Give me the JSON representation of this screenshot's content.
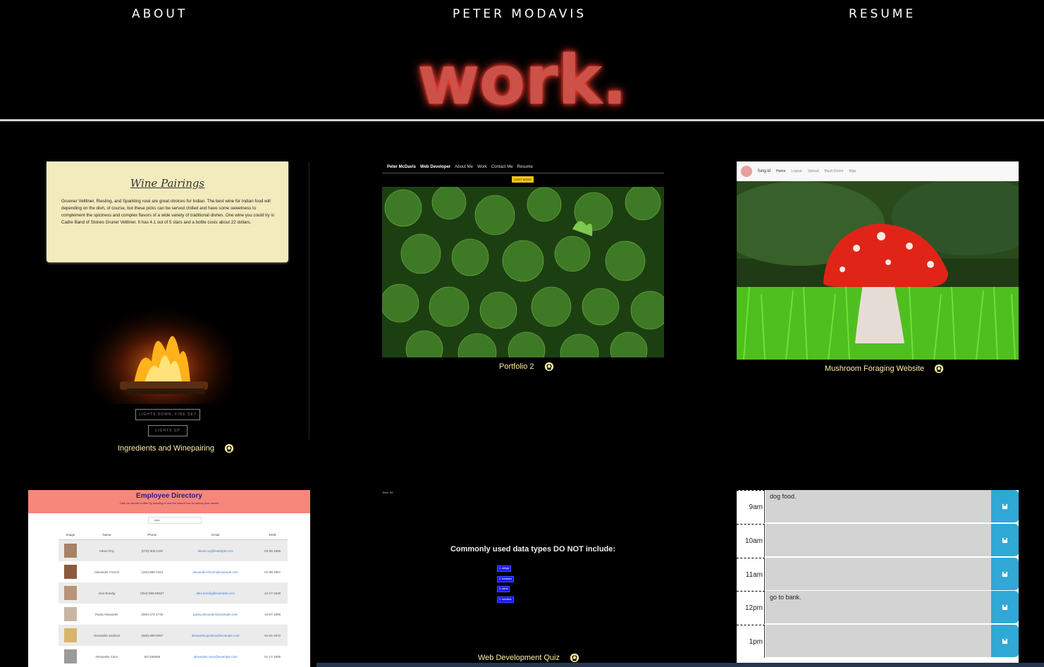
{
  "nav": {
    "about": "ABOUT",
    "name": "PETER MODAVIS",
    "resume": "RESUME"
  },
  "page_title": "work.",
  "projects": {
    "wine": {
      "caption": "Ingredients and Winepairing",
      "card_title": "Wine Pairings",
      "card_body": "Gruener Veltliner, Riesling, and Sparkling rosé are great choices for Indian. The best wine for Indian food will depending on the dish, of course, but these picks can be served chilled and have some sweetness to complement the spiciness and complex flavors of a wide variety of traditional dishes. One wine you could try is Cadre Band of Stones Gruner Veltliner. It has 4.1 out of 5 stars and a bottle costs about 22 dollars.",
      "btn_down": "LIGHTS DOWN, FIRE SET",
      "btn_up": "LIGHTS UP"
    },
    "portfolio": {
      "caption": "Portfolio 2",
      "nav_name": "Peter McDavis",
      "nav_role": "Web Developer",
      "nav_items": [
        "About Me",
        "Work",
        "Contact Me",
        "Resume"
      ],
      "light_mode": "LIGHT MODE"
    },
    "mushroom": {
      "caption": "Mushroom Foraging Website",
      "brand": "fung.id",
      "nav_items": [
        "Home",
        "Logout",
        "Upload",
        "Mush Room",
        "Map"
      ]
    },
    "employee": {
      "title": "Employee Directory",
      "subtitle": "Click on carrots to filter by heading or use the search box to narrow your results",
      "search_value": "Alex",
      "columns": [
        "Image",
        "Name",
        "Phone",
        "Email",
        "DOB"
      ],
      "rows": [
        {
          "name": "Alexis Roy",
          "phone": "(078)-305-1191",
          "email": "alexis.roy@example.com",
          "dob": "03-05-1956"
        },
        {
          "name": "Alexander French",
          "phone": "(150)-890-7261",
          "email": "alexander.french@example.com",
          "dob": "01-08-1967"
        },
        {
          "name": "Alex Bondig",
          "phone": "(064)-066-85227",
          "email": "alex.bondig@example.com",
          "dob": "12-17-1948"
        },
        {
          "name": "Paula Alexander",
          "phone": "(050)-272-1749",
          "email": "paula.alexander@example.com",
          "dob": "10-07-1990"
        },
        {
          "name": "Alexandra Jackson",
          "phone": "(360)-380-8067",
          "email": "alexandra.jackson@example.com",
          "dob": "01-01-1972"
        },
        {
          "name": "Alexander Cano",
          "phone": "927166556",
          "email": "alexander.cano@example.com",
          "dob": "01-17-1995"
        }
      ]
    },
    "quiz": {
      "caption": "Web Development Quiz",
      "time": "Time: 55",
      "question": "Commonly used data types DO NOT include:",
      "options": [
        "1. strings",
        "2. booleans",
        "3. alerts",
        "4. numbers"
      ]
    },
    "scheduler": {
      "rows": [
        {
          "hour": "9am",
          "text": "dog food."
        },
        {
          "hour": "10am",
          "text": ""
        },
        {
          "hour": "11am",
          "text": ""
        },
        {
          "hour": "12pm",
          "text": "go to bank."
        },
        {
          "hour": "1pm",
          "text": ""
        }
      ]
    }
  },
  "colors": {
    "title_red": "#cc5148",
    "caption_yellow": "#ffeca0",
    "save_blue": "#2fa8d6",
    "header_salmon": "#f6877a"
  }
}
